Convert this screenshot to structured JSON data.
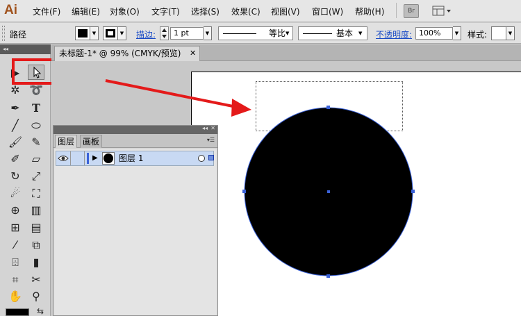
{
  "app": {
    "logo": "Ai"
  },
  "menu": {
    "items": [
      "文件(F)",
      "编辑(E)",
      "对象(O)",
      "文字(T)",
      "选择(S)",
      "效果(C)",
      "视图(V)",
      "窗口(W)",
      "帮助(H)"
    ],
    "bridge_label": "Br"
  },
  "control_bar": {
    "selection_label": "路径",
    "stroke_link": "描边:",
    "stroke_weight": "1 pt",
    "stroke_profile": "等比",
    "brush_def": "基本",
    "opacity_link": "不透明度:",
    "opacity_value": "100%",
    "style_label": "样式:"
  },
  "document": {
    "tab_title": "未标题-1* @ 99% (CMYK/预览)",
    "tab_close": "✕"
  },
  "layers_panel": {
    "tabs": [
      "图层",
      "画板"
    ],
    "active_tab": "图层",
    "layer_name": "图层 1"
  },
  "colors": {
    "accent_highlight": "#e41a1a",
    "selection_blue": "#3b62d8",
    "fill_black": "#000000"
  },
  "icons": {
    "tools": [
      "direct-selection-icon",
      "selection-icon",
      "magic-wand-icon",
      "lasso-icon",
      "pen-icon",
      "type-icon",
      "line-icon",
      "ellipse-icon",
      "paintbrush-icon",
      "pencil-icon",
      "blob-brush-icon",
      "eraser-icon",
      "rotate-icon",
      "scale-icon",
      "warp-icon",
      "free-transform-icon",
      "shape-builder-icon",
      "perspective-grid-icon",
      "mesh-icon",
      "gradient-icon",
      "eyedropper-icon",
      "blend-icon",
      "symbol-sprayer-icon",
      "column-graph-icon",
      "artboard-icon",
      "slice-icon",
      "hand-icon",
      "zoom-icon"
    ]
  }
}
